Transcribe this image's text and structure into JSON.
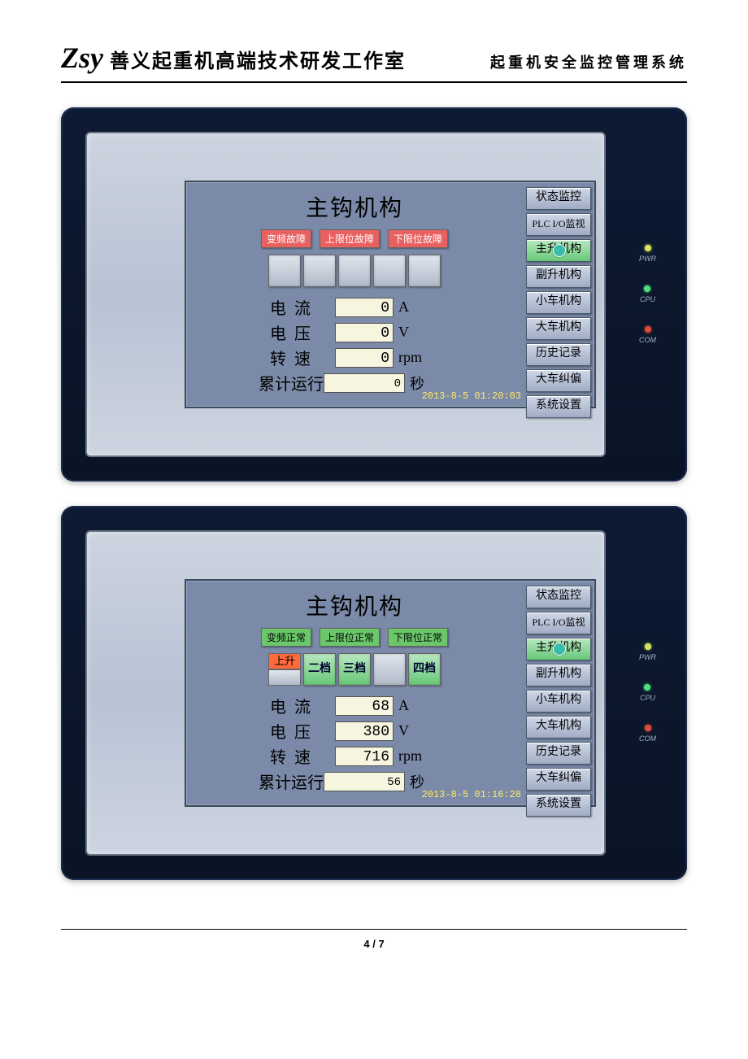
{
  "header": {
    "logo": "Zsy",
    "studio": "善义起重机高端技术研发工作室",
    "system": "起重机安全监控管理系统"
  },
  "leds": {
    "pwr": "PWR",
    "cpu": "CPU",
    "com": "COM"
  },
  "side_buttons": [
    "状态监控",
    "PLC I/O监视",
    "主升机构",
    "副升机构",
    "小车机构",
    "大车机构",
    "历史记录",
    "大车纠偏",
    "系统设置"
  ],
  "panel1": {
    "title": "主钩机构",
    "alerts": [
      "变频故障",
      "上限位故障",
      "下限位故障"
    ],
    "gears": [
      "",
      "",
      "",
      "",
      ""
    ],
    "readings": {
      "current_label": "电流",
      "current_value": "0",
      "current_unit": "A",
      "voltage_label": "电压",
      "voltage_value": "0",
      "voltage_unit": "V",
      "speed_label": "转速",
      "speed_value": "0",
      "speed_unit": "rpm",
      "runtime_label": "累计运行",
      "runtime_value": "0",
      "runtime_unit": "秒"
    },
    "timestamp": "2013-8-5 01:20:03"
  },
  "panel2": {
    "title": "主钩机构",
    "alerts": [
      "变频正常",
      "上限位正常",
      "下限位正常"
    ],
    "gears_split_top": "上升",
    "gears_labels": [
      "二档",
      "三档",
      "四档"
    ],
    "readings": {
      "current_label": "电流",
      "current_value": "68",
      "current_unit": "A",
      "voltage_label": "电压",
      "voltage_value": "380",
      "voltage_unit": "V",
      "speed_label": "转速",
      "speed_value": "716",
      "speed_unit": "rpm",
      "runtime_label": "累计运行",
      "runtime_value": "56",
      "runtime_unit": "秒"
    },
    "timestamp": "2013-8-5 01:16:28"
  },
  "pager": {
    "current": "4",
    "sep": "/",
    "total": "7"
  }
}
